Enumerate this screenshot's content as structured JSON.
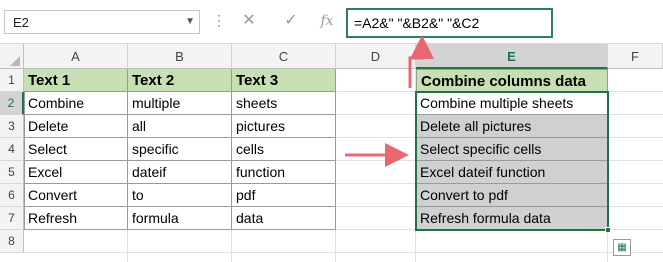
{
  "name_box": {
    "value": "E2",
    "dropdown_icon": "chevron-down-icon"
  },
  "formula_bar": {
    "cancel_icon": "close-icon",
    "enter_icon": "check-icon",
    "function_icon": "fx-icon",
    "formula": "=A2&\" \"&B2&\" \"&C2"
  },
  "columns": [
    "A",
    "B",
    "C",
    "D",
    "E",
    "F"
  ],
  "rows": [
    "1",
    "2",
    "3",
    "4",
    "5",
    "6",
    "7",
    "8"
  ],
  "selected_column": "E",
  "selected_row": "2",
  "header_row": {
    "a": "Text 1",
    "b": "Text 2",
    "c": "Text 3",
    "e": "Combine columns data"
  },
  "data_rows": [
    {
      "a": "Combine",
      "b": "multiple",
      "c": "sheets",
      "e": "Combine multiple sheets"
    },
    {
      "a": "Delete",
      "b": "all",
      "c": "pictures",
      "e": "Delete all pictures"
    },
    {
      "a": "Select",
      "b": "specific",
      "c": "cells",
      "e": "Select specific cells"
    },
    {
      "a": "Excel",
      "b": "dateif",
      "c": "function",
      "e": "Excel dateif function"
    },
    {
      "a": "Convert",
      "b": "to",
      "c": "pdf",
      "e": "Convert to pdf"
    },
    {
      "a": "Refresh",
      "b": "formula",
      "c": "data",
      "e": "Refresh formula data"
    }
  ],
  "colors": {
    "header_fill": "#c6e0b4",
    "result_fill": "#d0d0d0",
    "selection": "#217346",
    "arrow": "#e8686f",
    "formula_box_border": "#2f7f5f"
  },
  "quick_analysis_icon": "quick-analysis-icon"
}
